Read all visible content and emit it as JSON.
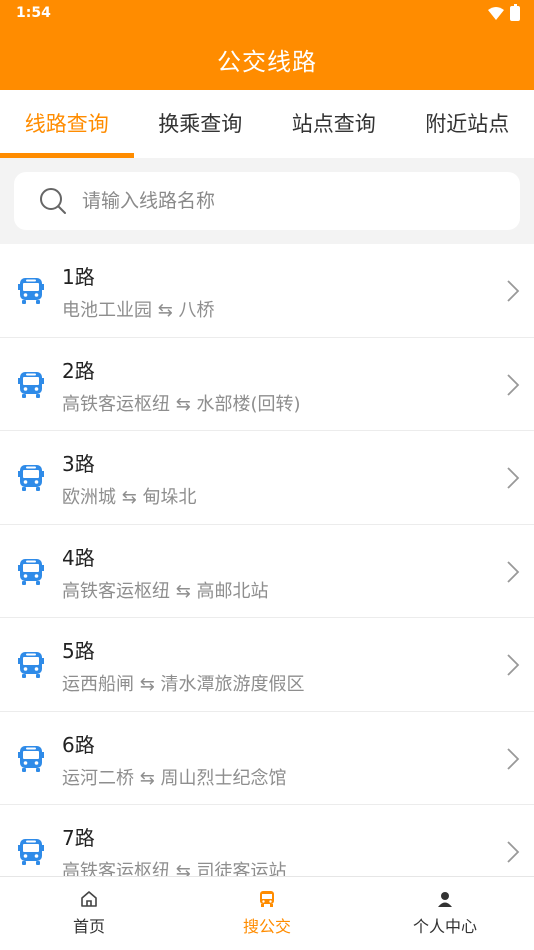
{
  "status_bar": {
    "time": "1:54"
  },
  "header": {
    "title": "公交线路"
  },
  "tabs": [
    {
      "label": "线路查询",
      "active": true
    },
    {
      "label": "换乘查询",
      "active": false
    },
    {
      "label": "站点查询",
      "active": false
    },
    {
      "label": "附近站点",
      "active": false
    }
  ],
  "search": {
    "placeholder": "请输入线路名称",
    "value": ""
  },
  "routes": [
    {
      "name": "1路",
      "stops": "电池工业园 ⇆ 八桥"
    },
    {
      "name": "2路",
      "stops": "高铁客运枢纽 ⇆ 水部楼(回转)"
    },
    {
      "name": "3路",
      "stops": "欧洲城 ⇆ 甸垛北"
    },
    {
      "name": "4路",
      "stops": "高铁客运枢纽 ⇆ 高邮北站"
    },
    {
      "name": "5路",
      "stops": "运西船闸 ⇆ 清水潭旅游度假区"
    },
    {
      "name": "6路",
      "stops": "运河二桥 ⇆ 周山烈士纪念馆"
    },
    {
      "name": "7路",
      "stops": "高铁客运枢纽 ⇆ 司徒客运站"
    }
  ],
  "bottom_nav": [
    {
      "label": "首页",
      "active": false
    },
    {
      "label": "搜公交",
      "active": true
    },
    {
      "label": "个人中心",
      "active": false
    }
  ],
  "colors": {
    "accent": "#ff8c00",
    "bus_icon": "#2f8be8"
  }
}
